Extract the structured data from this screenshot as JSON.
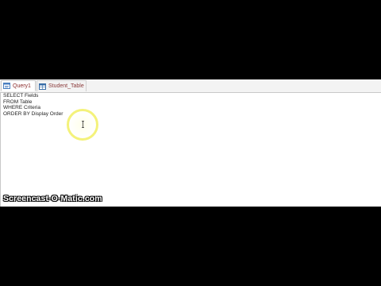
{
  "tabs": [
    {
      "label": "Query1",
      "icon": "query-icon",
      "active": true
    },
    {
      "label": "Student_Table",
      "icon": "table-icon",
      "active": false
    }
  ],
  "editor": {
    "lines": [
      "SELECT Fields",
      "FROM Table",
      "WHERE Criteria",
      "ORDER BY Display Order"
    ]
  },
  "watermark": "Screencast-O-Matic.com",
  "colors": {
    "letterbox": "#000000",
    "tab_text": "#8a2a2a",
    "highlight_ring": "#f4f27a"
  }
}
